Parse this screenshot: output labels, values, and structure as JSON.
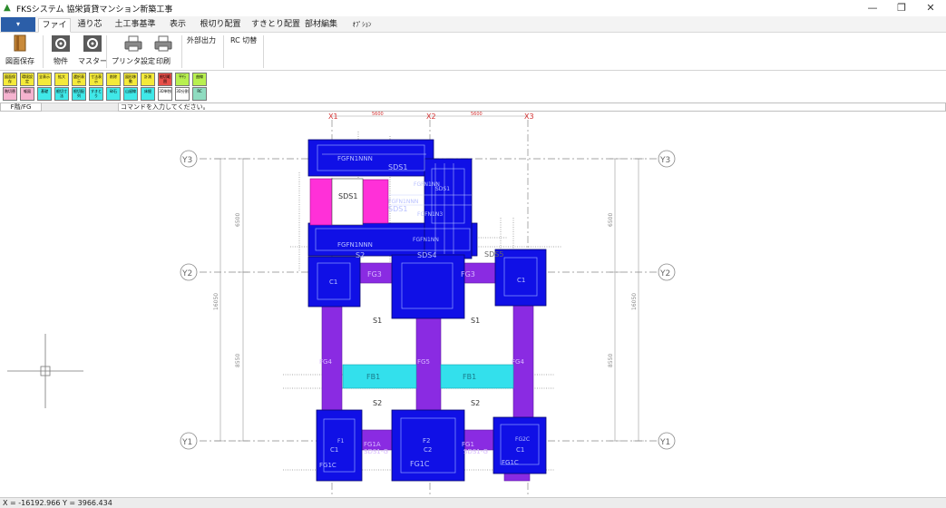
{
  "window": {
    "title": "FKSシステム  協栄賃貸マンション新築工事",
    "controls": {
      "minimize": "—",
      "maximize": "❐",
      "close": "✕"
    }
  },
  "tabs": {
    "menu_glyph": "▾",
    "items": [
      "ファイル",
      "通り芯",
      "土工事基準",
      "表示",
      "根切り配置",
      "すきとり配置",
      "部材編集",
      "ｵﾌﾟｼｮﾝ"
    ]
  },
  "ribbon": {
    "save": "図面保存",
    "project": "物件",
    "master": "マスター",
    "printer_setup": "プリンタ設定",
    "print": "印刷",
    "external_output": "外部出力",
    "rc_switch": "RC 切替"
  },
  "toolbar": {
    "row1": [
      {
        "label": "図面保存",
        "color": "#f4ea3a"
      },
      {
        "label": "環境設定",
        "color": "#f4ea3a"
      },
      {
        "label": "全表示",
        "color": "#f4ea3a"
      },
      {
        "label": "拡大",
        "color": "#f4ea3a"
      },
      {
        "label": "選択表示",
        "color": "#f4ea3a"
      },
      {
        "label": "寸法表示",
        "color": "#f4ea3a"
      },
      {
        "label": "削除",
        "color": "#f4ea3a"
      },
      {
        "label": "図形移動",
        "color": "#f4ea3a"
      },
      {
        "label": "計測",
        "color": "#f4ea3a"
      },
      {
        "label": "根切範囲",
        "color": "#e8504a"
      },
      {
        "label": "平行",
        "color": "#b8f050"
      },
      {
        "label": "曲線",
        "color": "#b8f050"
      }
    ],
    "row2": [
      {
        "label": "階切替",
        "color": "#f5b3cf"
      },
      {
        "label": "躯図",
        "color": "#f5b3cf"
      },
      {
        "label": "基礎",
        "color": "#40e8e8"
      },
      {
        "label": "根切寸法",
        "color": "#40e8e8"
      },
      {
        "label": "根切配列",
        "color": "#40e8e8"
      },
      {
        "label": "すきとり",
        "color": "#40e8e8"
      },
      {
        "label": "砕石",
        "color": "#40e8e8"
      },
      {
        "label": "山留線",
        "color": "#40e8e8"
      },
      {
        "label": "床掘",
        "color": "#40e8e8"
      },
      {
        "label": "3D単独",
        "color": "#ffffff"
      },
      {
        "label": "3D分割",
        "color": "#ffffff"
      },
      {
        "label": "RC",
        "color": "#8fdcc0"
      }
    ]
  },
  "command": {
    "level": "F階/FG",
    "prompt": "コマンドを入力してください。"
  },
  "drawing": {
    "axes_x": [
      "X1",
      "X2",
      "X3"
    ],
    "axes_y": [
      "Y1",
      "Y2",
      "Y3"
    ],
    "spans_x": [
      "5600",
      "5600"
    ],
    "dims_left": [
      "6500",
      "8550",
      "16050"
    ],
    "dims_right": [
      "6500",
      "8550",
      "16050"
    ],
    "labels": {
      "sds1_a": "SDS1",
      "sds1_b": "SDS1",
      "sds1_c": "SDS1",
      "sds1_d": "SDS1",
      "sds4": "SDS4",
      "sds5": "SDS5",
      "s1_a": "S1",
      "s1_b": "S1",
      "s2_a": "S2",
      "s2_b": "S2",
      "s2_c": "S2",
      "fb1_a": "FB1",
      "fb1_b": "FB1",
      "fg3_a": "FG3",
      "fg3_b": "FG3",
      "fg4_a": "FG4",
      "fg4_b": "FG4",
      "fg5": "FG5",
      "fg1a": "FG1A",
      "fg1_a": "FG1",
      "fg1c_a": "FG1C",
      "fg1c_b": "FG1C",
      "fg1c_c": "FG1C",
      "fg2c": "FG2C",
      "f1": "F1",
      "f2": "F2",
      "c1_a": "C1",
      "c1_b": "C1",
      "c1_c": "C1",
      "c1_d": "C1",
      "c2": "C2",
      "sds1g_a": "SDS1-G",
      "sds1g_b": "SDS1-G",
      "fgfn1_a": "FGFN1NNN",
      "fgfn1_b": "FGFN1NNN",
      "fgfn1_c": "FGFN1NNN",
      "fgfn1_d": "FGFN1NN",
      "fgfn1_e": "FGFN1NN",
      "fgfn1_f": "FGFN1N3"
    }
  },
  "status": {
    "coords": "X = -16192.966 Y = 3966.434"
  },
  "colors": {
    "footing": "#1010e6",
    "beam": "#8a2be2",
    "slab_pink": "#ff30d8",
    "fb": "#33e0ec",
    "axis_red": "#d23030",
    "grid": "#888888"
  }
}
